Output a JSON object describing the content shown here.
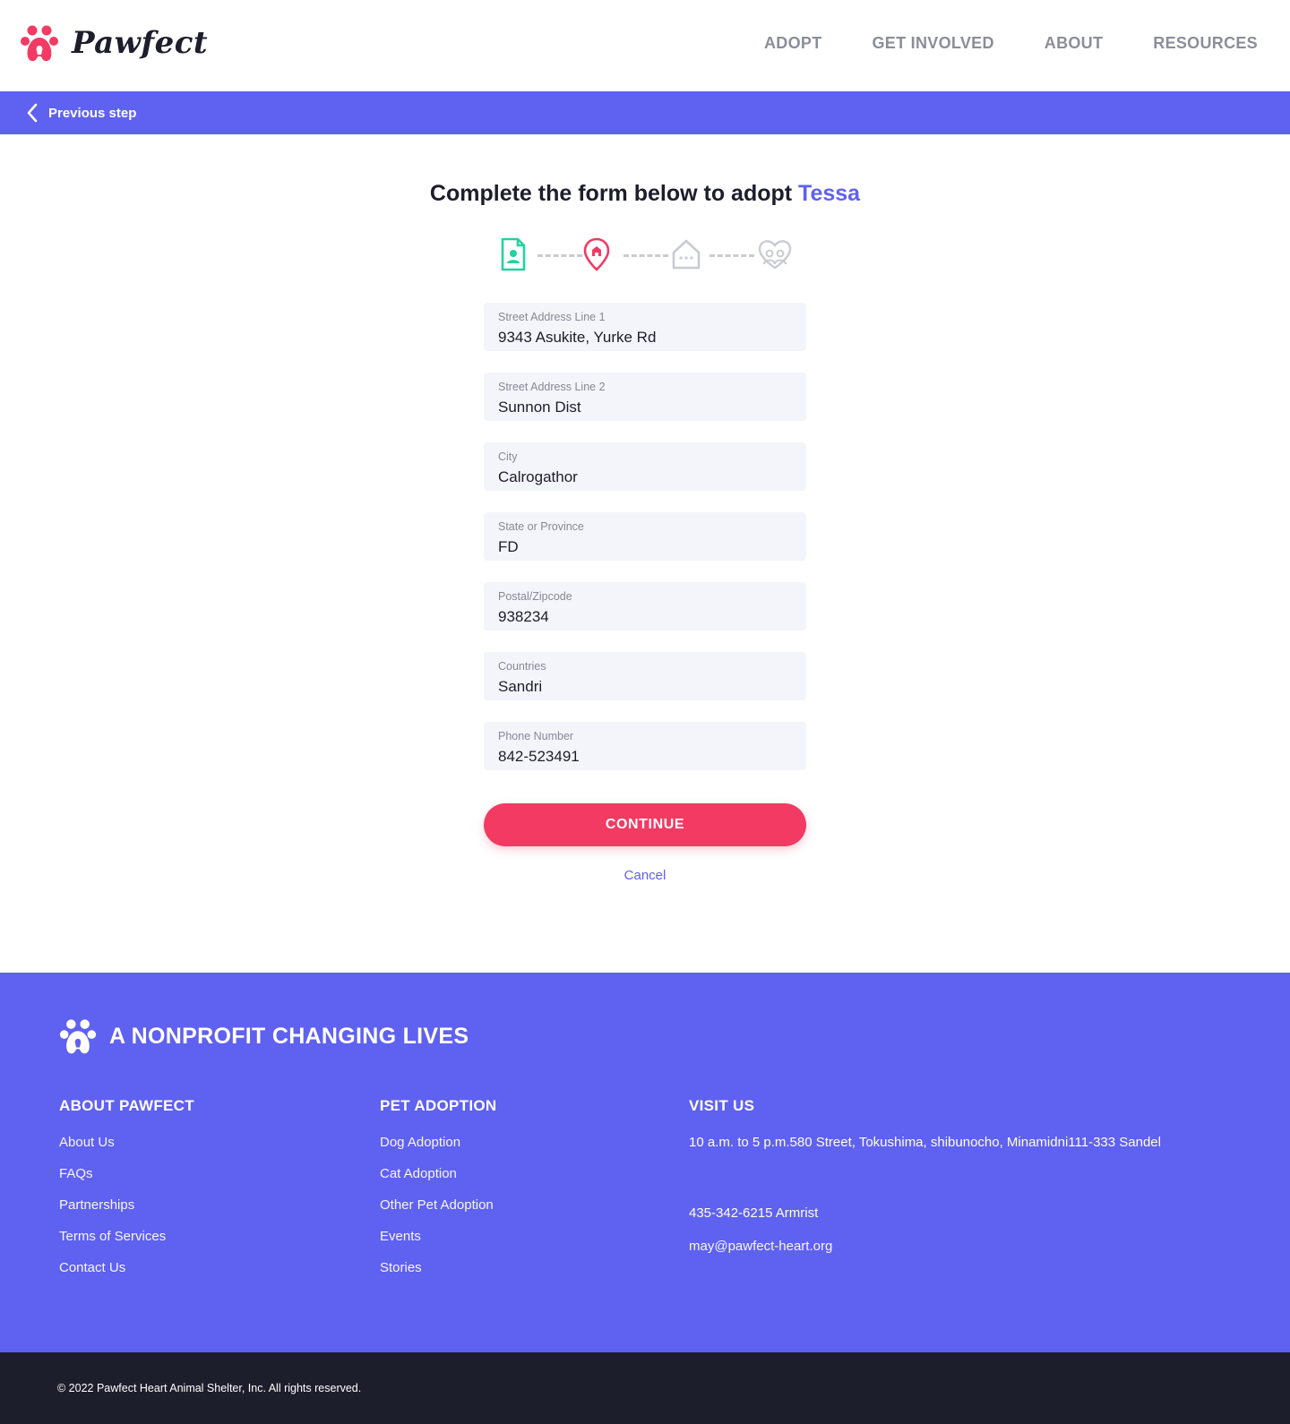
{
  "brand": {
    "name": "Pawfect",
    "accent": "#5f61f0",
    "primary": "#f23a63"
  },
  "nav": {
    "items": [
      "ADOPT",
      "GET INVOLVED",
      "ABOUT",
      "RESOURCES"
    ]
  },
  "stepbar": {
    "label": "Previous step"
  },
  "form": {
    "title_prefix": "Complete the form below to adopt",
    "pet_name": "Tessa",
    "steps": [
      {
        "icon": "contact-card-icon",
        "status": "completed"
      },
      {
        "icon": "location-pin-icon",
        "status": "current"
      },
      {
        "icon": "house-icon",
        "status": "upcoming"
      },
      {
        "icon": "family-icon",
        "status": "upcoming"
      }
    ],
    "fields": [
      {
        "label": "Street Address Line 1",
        "value": "9343 Asukite, Yurke Rd"
      },
      {
        "label": "Street Address Line 2",
        "value": "Sunnon Dist"
      },
      {
        "label": "City",
        "value": "Calrogathor"
      },
      {
        "label": "State or Province",
        "value": "FD"
      },
      {
        "label": "Postal/Zipcode",
        "value": "938234"
      },
      {
        "label": "Countries",
        "value": "Sandri"
      },
      {
        "label": "Phone Number",
        "value": "842-523491"
      }
    ],
    "continue_label": "CONTINUE",
    "cancel_label": "Cancel"
  },
  "footer": {
    "tagline": "A NONPROFIT CHANGING LIVES",
    "about": {
      "heading": "ABOUT PAWFECT",
      "links": [
        "About Us",
        "FAQs",
        "Partnerships",
        "Terms of Services",
        "Contact Us"
      ]
    },
    "adoption": {
      "heading": "PET ADOPTION",
      "links": [
        "Dog Adoption",
        "Cat Adoption",
        "Other Pet Adoption",
        "Events",
        "Stories"
      ]
    },
    "visit": {
      "heading": "VISIT US",
      "address": "10 a.m. to 5 p.m.580 Street, Tokushima, shibunocho, Minamidni111-333 Sandel",
      "phone": "435-342-6215 Armrist",
      "email": "may@pawfect-heart.org"
    },
    "copyright": "© 2022 Pawfect Heart Animal Shelter, Inc. All rights reserved."
  }
}
